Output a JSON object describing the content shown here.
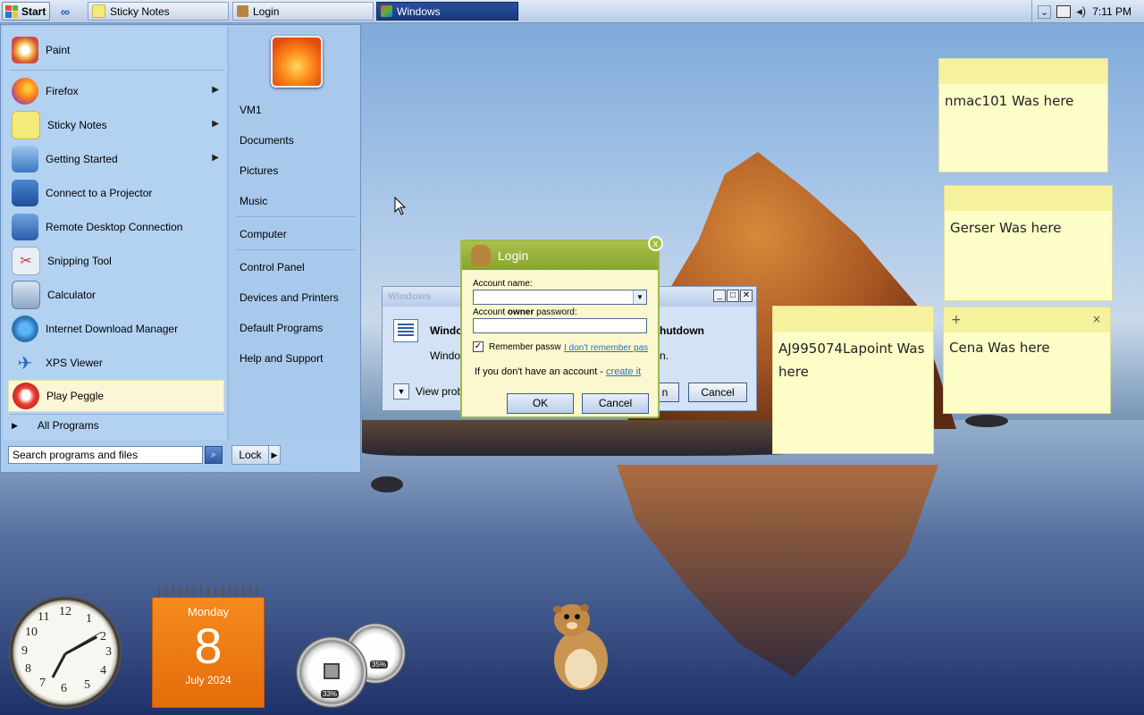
{
  "taskbar": {
    "start_label": "Start",
    "tasks": [
      {
        "label": "Sticky Notes"
      },
      {
        "label": "Login"
      },
      {
        "label": "Windows"
      }
    ],
    "tray_chevron": "⌄",
    "time": "7:11 PM"
  },
  "start_menu": {
    "programs": [
      {
        "label": "Paint",
        "icon": "paint-icon"
      },
      {
        "label": "Firefox",
        "icon": "firefox-icon"
      },
      {
        "label": "Sticky Notes",
        "icon": "sticky-notes-icon"
      },
      {
        "label": "Getting Started",
        "icon": "getting-started-icon"
      },
      {
        "label": "Connect to a Projector",
        "icon": "projector-icon"
      },
      {
        "label": "Remote Desktop Connection",
        "icon": "remote-desktop-icon"
      },
      {
        "label": "Snipping Tool",
        "icon": "scissors-icon"
      },
      {
        "label": "Calculator",
        "icon": "calculator-icon"
      },
      {
        "label": "Internet Download Manager",
        "icon": "download-manager-icon"
      },
      {
        "label": "XPS Viewer",
        "icon": "xps-viewer-icon"
      },
      {
        "label": "Play Peggle",
        "icon": "peggle-icon"
      }
    ],
    "all_programs": "All Programs",
    "search_placeholder": "Search programs and files",
    "lock_label": "Lock",
    "places": [
      {
        "label": "VM1"
      },
      {
        "label": "Documents"
      },
      {
        "label": "Pictures"
      },
      {
        "label": "Music"
      },
      {
        "label": "Computer"
      },
      {
        "label": "Control Panel"
      },
      {
        "label": "Devices and Printers"
      },
      {
        "label": "Default Programs"
      },
      {
        "label": "Help and Support"
      }
    ]
  },
  "bg_dialog": {
    "title": "Windows",
    "heading_left": "Windo",
    "heading_right": "hutdown",
    "line2_left": "Window",
    "line2_right": "n.",
    "view_problems": "View proble",
    "partial_button": "n",
    "cancel": "Cancel"
  },
  "login": {
    "title": "Login",
    "account_label": "Account name:",
    "password_label_pre": "Account ",
    "password_label_bold": "owner",
    "password_label_post": " password:",
    "remember": "Remember passw",
    "forgot_link": "I don't remember pas",
    "no_account": "If you don't have an account - ",
    "create_link": "create it",
    "ok": "OK",
    "cancel": "Cancel",
    "close": "x"
  },
  "notes": [
    {
      "text": "nmac101 Was here"
    },
    {
      "text": "Gerser Was here"
    },
    {
      "text": "AJ995074Lapoint Was here"
    },
    {
      "text": "Cena Was here"
    }
  ],
  "note_controls": {
    "plus": "+",
    "close": "×"
  },
  "gadgets": {
    "calendar": {
      "weekday": "Monday",
      "day": "8",
      "month_year": "July 2024"
    },
    "clock_numbers": [
      "12",
      "1",
      "2",
      "3",
      "4",
      "5",
      "6",
      "7",
      "8",
      "9",
      "10",
      "11"
    ],
    "cpu_percent": "33%",
    "memory_percent": "35%"
  },
  "colors": {
    "taskbar_active": "#1f4489",
    "note_bg": "#fdfdc8",
    "calendar_orange": "#f07a14",
    "login_green": "#9ab845"
  }
}
